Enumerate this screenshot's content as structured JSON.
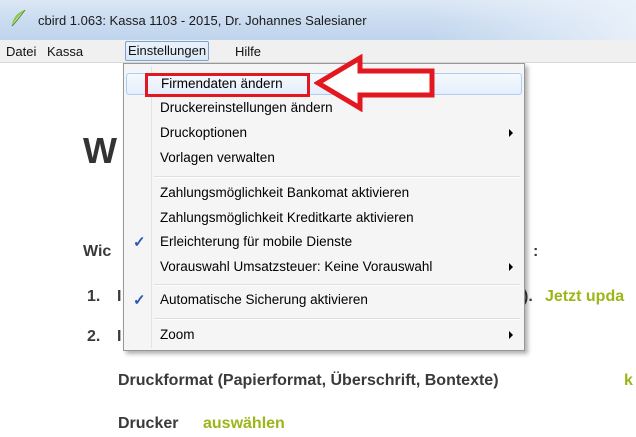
{
  "window": {
    "title": "cbird 1.063: Kassa 1103 - 2015, Dr. Johannes Salesianer"
  },
  "menubar": {
    "items": [
      "Datei",
      "Kassa",
      "Einstellungen",
      "Hilfe"
    ]
  },
  "content": {
    "title_fragment": "W",
    "line1": "Wic",
    "line1_tail": ":",
    "item1_num": "1.",
    "item1_frag": "I",
    "item1_tail": ").",
    "item1_link": "Jetzt upda",
    "item2_num": "2.",
    "item2_frag": "I",
    "druckformat_text": "Druckformat (Papierformat, Überschrift, Bontexte)",
    "druckformat_link": "k",
    "drucker_text": "Drucker",
    "drucker_link": "auswählen"
  },
  "dropdown": {
    "items": [
      {
        "label": "Firmendaten ändern",
        "checked": false,
        "submenu": false
      },
      {
        "label": "Druckereinstellungen ändern",
        "checked": false,
        "submenu": false
      },
      {
        "label": "Druckoptionen",
        "checked": false,
        "submenu": true
      },
      {
        "label": "Vorlagen verwalten",
        "checked": false,
        "submenu": false
      },
      {
        "label": "Zahlungsmöglichkeit Bankomat aktivieren",
        "checked": false,
        "submenu": false
      },
      {
        "label": "Zahlungsmöglichkeit Kreditkarte aktivieren",
        "checked": false,
        "submenu": false
      },
      {
        "label": "Erleichterung für mobile Dienste",
        "checked": true,
        "submenu": false
      },
      {
        "label": "Vorauswahl Umsatzsteuer: Keine Vorauswahl",
        "checked": false,
        "submenu": true
      },
      {
        "label": "Automatische Sicherung aktivieren",
        "checked": true,
        "submenu": false
      },
      {
        "label": "Zoom",
        "checked": false,
        "submenu": true
      }
    ],
    "check_glyph": "✓"
  },
  "colors": {
    "link_green": "#9ab619",
    "annotation_red": "#e3171f",
    "check_blue": "#2a59b8"
  },
  "icons": {
    "app": "cbird-leaf-icon"
  }
}
